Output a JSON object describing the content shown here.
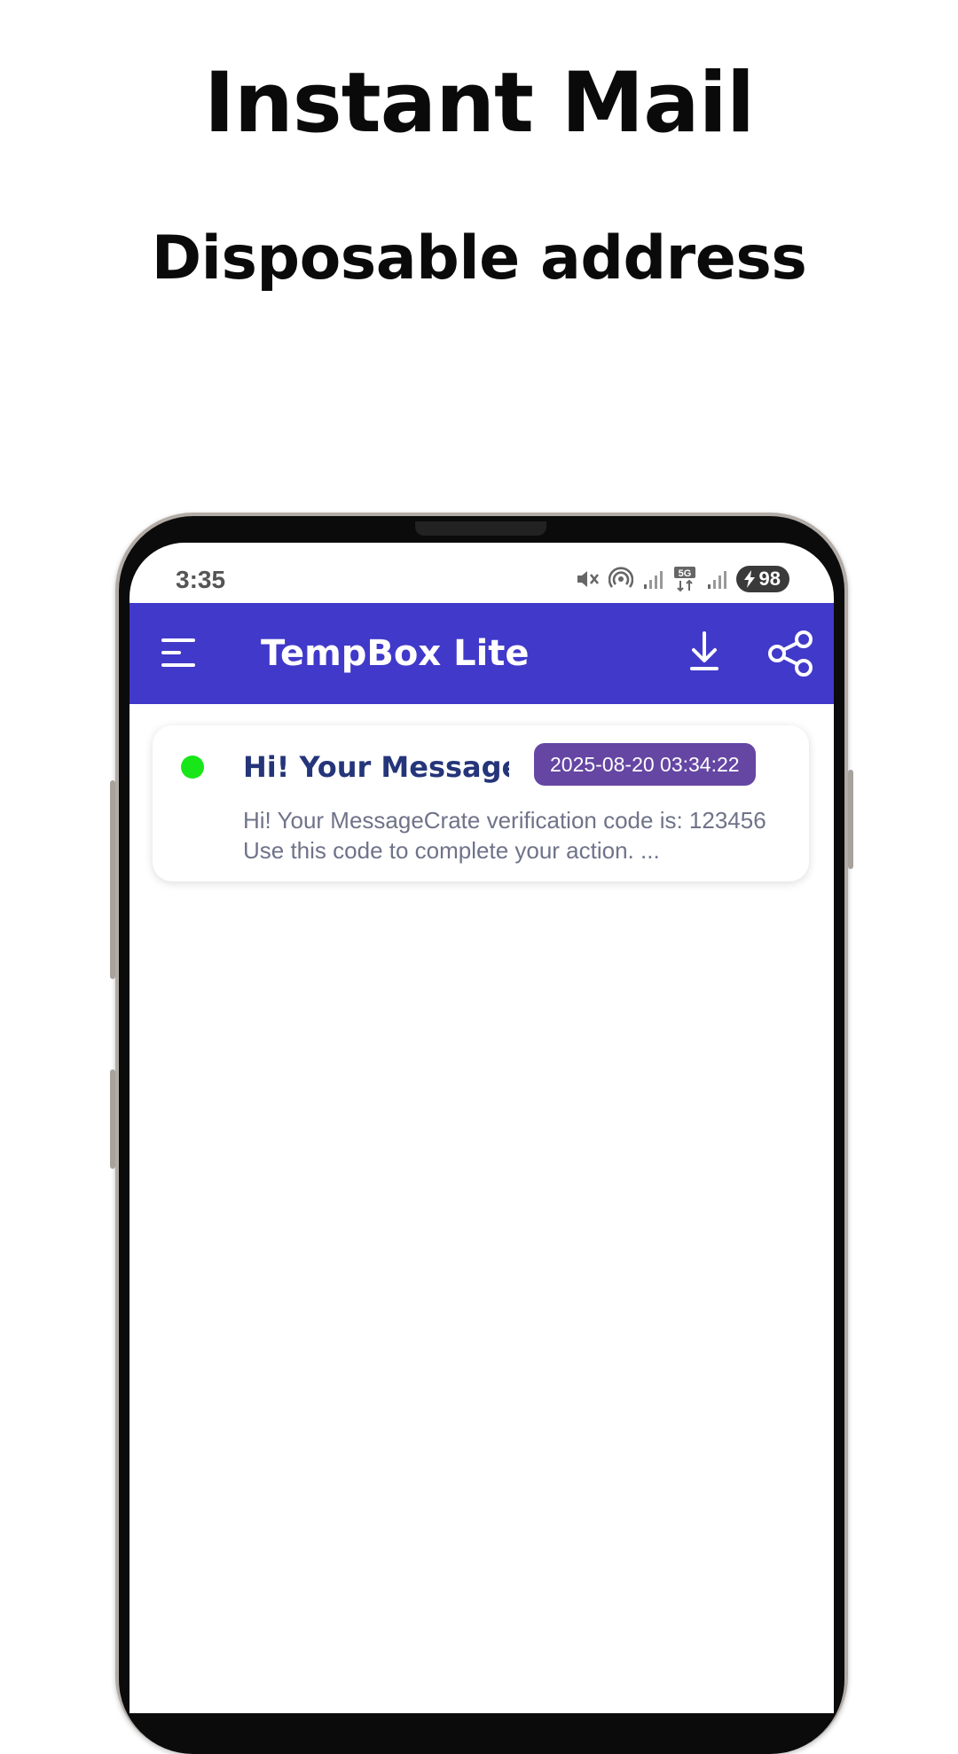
{
  "promo": {
    "headline": "Instant Mail",
    "subheadline": "Disposable address"
  },
  "status_bar": {
    "time": "3:35",
    "battery": "98",
    "network": "5G",
    "icons": [
      "mute-icon",
      "hotspot-icon",
      "signal-icon",
      "5g-data-icon",
      "signal-icon",
      "battery-charging-icon"
    ]
  },
  "app_bar": {
    "title": "TempBox Lite",
    "menu_icon": "menu-icon",
    "download_icon": "download-icon",
    "share_icon": "share-icon",
    "color": "#4139c9"
  },
  "messages": [
    {
      "subject": "Hi! Your Message...",
      "date": "2025-08-20 03:34:22",
      "preview": "Hi! Your MessageCrate verification code is: 123456 Use this code to complete your action. ...",
      "unread": true,
      "unread_color": "#19e619",
      "date_badge_color": "#6546a3"
    }
  ]
}
